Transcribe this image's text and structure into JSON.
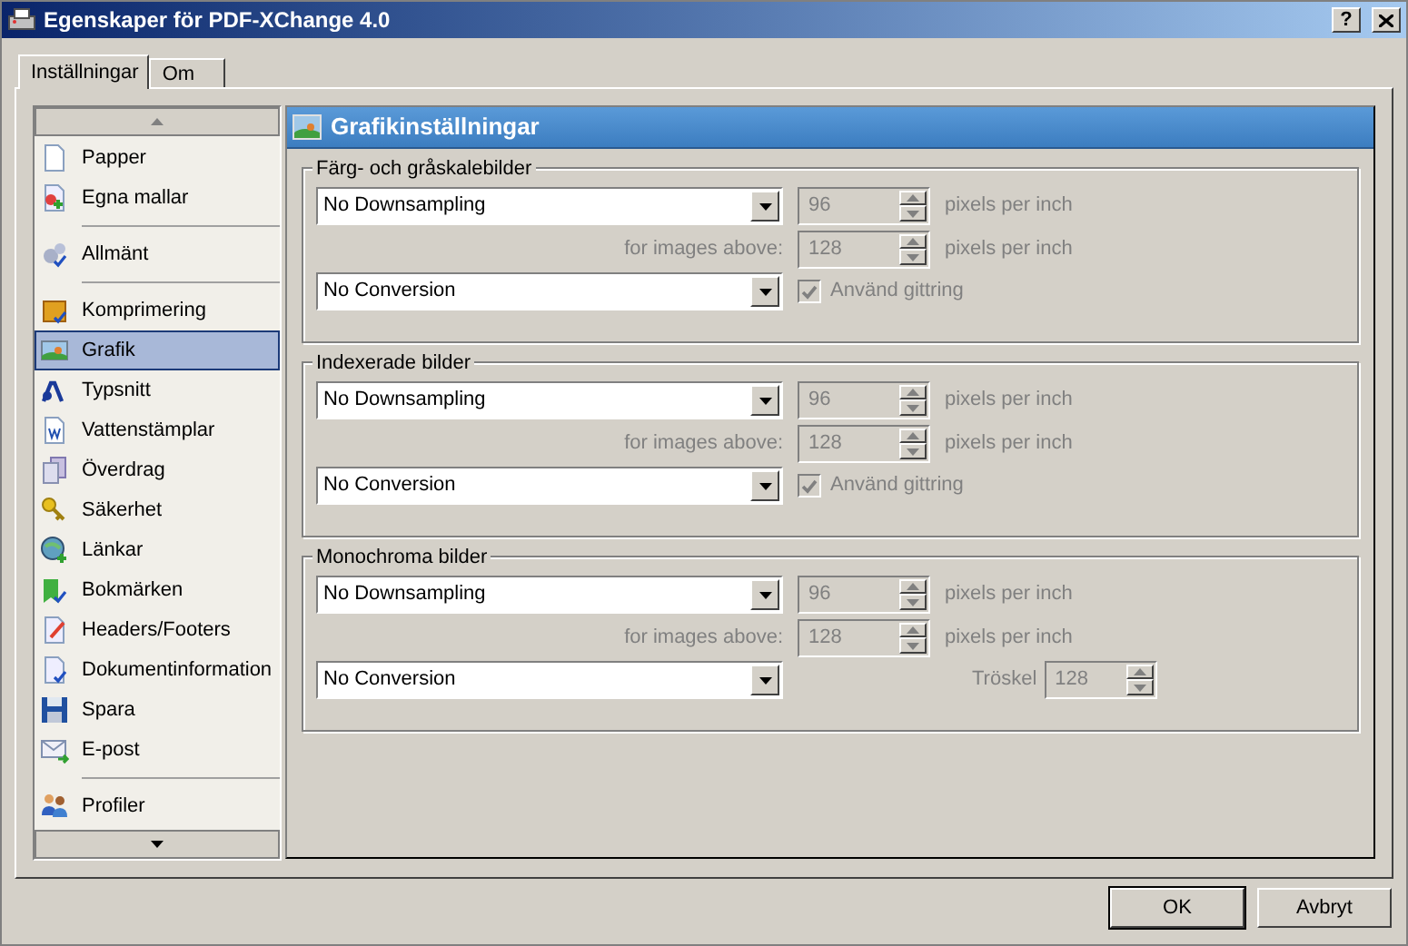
{
  "window": {
    "title": "Egenskaper för PDF-XChange 4.0",
    "help": "?"
  },
  "tabs": [
    {
      "label": "Inställningar",
      "selected": true
    },
    {
      "label": "Om",
      "selected": false
    }
  ],
  "sidebar": {
    "items": [
      {
        "label": "Papper",
        "selected": false,
        "separator_before": false
      },
      {
        "label": "Egna mallar",
        "selected": false,
        "separator_before": false
      },
      {
        "label": "Allmänt",
        "selected": false,
        "separator_before": true
      },
      {
        "label": "Komprimering",
        "selected": false,
        "separator_before": true
      },
      {
        "label": "Grafik",
        "selected": true,
        "separator_before": false
      },
      {
        "label": "Typsnitt",
        "selected": false,
        "separator_before": false
      },
      {
        "label": "Vattenstämplar",
        "selected": false,
        "separator_before": false
      },
      {
        "label": "Överdrag",
        "selected": false,
        "separator_before": false
      },
      {
        "label": "Säkerhet",
        "selected": false,
        "separator_before": false
      },
      {
        "label": "Länkar",
        "selected": false,
        "separator_before": false
      },
      {
        "label": "Bokmärken",
        "selected": false,
        "separator_before": false
      },
      {
        "label": "Headers/Footers",
        "selected": false,
        "separator_before": false
      },
      {
        "label": "Dokumentinformation",
        "selected": false,
        "separator_before": false
      },
      {
        "label": "Spara",
        "selected": false,
        "separator_before": false
      },
      {
        "label": "E-post",
        "selected": false,
        "separator_before": false
      },
      {
        "label": "Profiler",
        "selected": false,
        "separator_before": true
      }
    ]
  },
  "page": {
    "title": "Grafikinställningar"
  },
  "groups": [
    {
      "title": "Färg- och gråskalebilder",
      "downsampling": "No Downsampling",
      "resolution": {
        "value": "96",
        "unit": "pixels per inch",
        "disabled": true
      },
      "above": {
        "label": "for images above:",
        "value": "128",
        "unit": "pixels per inch",
        "disabled": true
      },
      "conversion": "No Conversion",
      "extra": {
        "kind": "checkbox",
        "label": "Använd gittring",
        "checked": true,
        "disabled": true
      }
    },
    {
      "title": "Indexerade bilder",
      "downsampling": "No Downsampling",
      "resolution": {
        "value": "96",
        "unit": "pixels per inch",
        "disabled": true
      },
      "above": {
        "label": "for images above:",
        "value": "128",
        "unit": "pixels per inch",
        "disabled": true
      },
      "conversion": "No Conversion",
      "extra": {
        "kind": "checkbox",
        "label": "Använd gittring",
        "checked": true,
        "disabled": true
      }
    },
    {
      "title": "Monochroma bilder",
      "downsampling": "No Downsampling",
      "resolution": {
        "value": "96",
        "unit": "pixels per inch",
        "disabled": true
      },
      "above": {
        "label": "for images above:",
        "value": "128",
        "unit": "pixels per inch",
        "disabled": true
      },
      "conversion": "No Conversion",
      "extra": {
        "kind": "threshold",
        "label": "Tröskel",
        "value": "128",
        "disabled": true
      }
    }
  ],
  "buttons": [
    {
      "label": "OK",
      "default": true
    },
    {
      "label": "Avbryt",
      "default": false
    }
  ]
}
